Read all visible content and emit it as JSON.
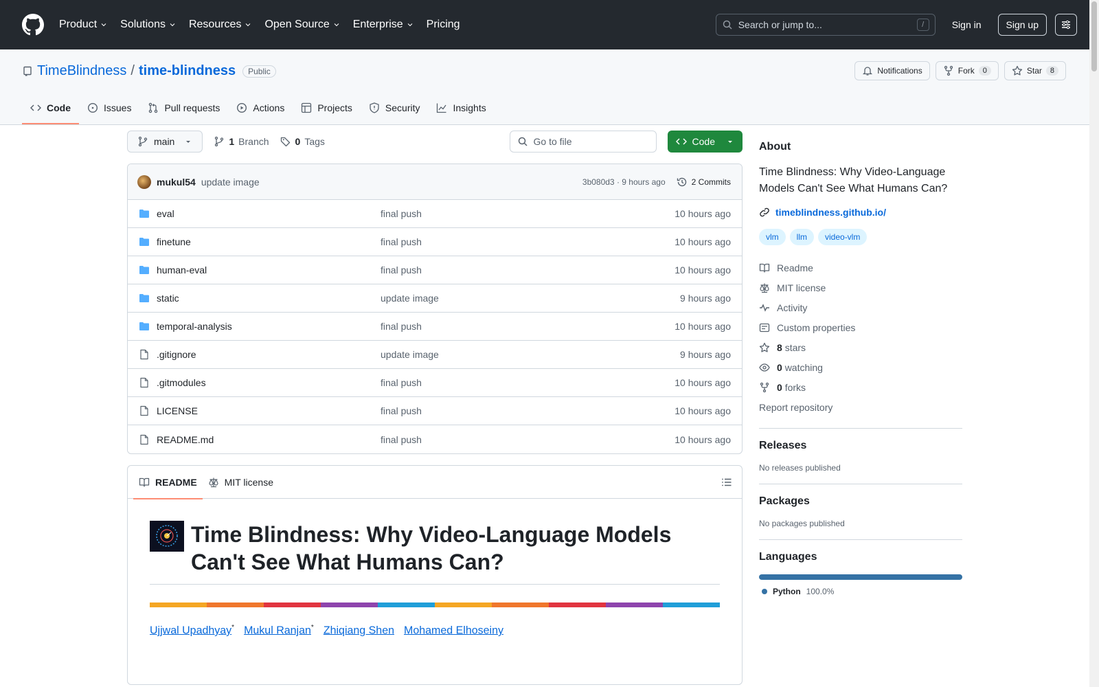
{
  "topnav": {
    "items": [
      "Product",
      "Solutions",
      "Resources",
      "Open Source",
      "Enterprise",
      "Pricing"
    ],
    "search_placeholder": "Search or jump to...",
    "search_shortcut": "/",
    "signin": "Sign in",
    "signup": "Sign up"
  },
  "repo": {
    "owner": "TimeBlindness",
    "name": "time-blindness",
    "visibility": "Public",
    "notifications_label": "Notifications",
    "fork_label": "Fork",
    "fork_count": "0",
    "star_label": "Star",
    "star_count": "8"
  },
  "tabs": [
    "Code",
    "Issues",
    "Pull requests",
    "Actions",
    "Projects",
    "Security",
    "Insights"
  ],
  "toolbar": {
    "branch": "main",
    "branch_count": "1",
    "branch_label": "Branch",
    "tag_count": "0",
    "tag_label": "Tags",
    "goto_placeholder": "Go to file",
    "code_label": "Code"
  },
  "commit": {
    "author": "mukul54",
    "message": "update image",
    "sha_time": "3b080d3 · 9 hours ago",
    "commits": "2 Commits"
  },
  "files": [
    {
      "name": "eval",
      "type": "dir",
      "msg": "final push",
      "date": "10 hours ago"
    },
    {
      "name": "finetune",
      "type": "dir",
      "msg": "final push",
      "date": "10 hours ago"
    },
    {
      "name": "human-eval",
      "type": "dir",
      "msg": "final push",
      "date": "10 hours ago"
    },
    {
      "name": "static",
      "type": "dir",
      "msg": "update image",
      "date": "9 hours ago"
    },
    {
      "name": "temporal-analysis",
      "type": "dir",
      "msg": "final push",
      "date": "10 hours ago"
    },
    {
      "name": ".gitignore",
      "type": "file",
      "msg": "update image",
      "date": "9 hours ago"
    },
    {
      "name": ".gitmodules",
      "type": "file",
      "msg": "final push",
      "date": "10 hours ago"
    },
    {
      "name": "LICENSE",
      "type": "file",
      "msg": "final push",
      "date": "10 hours ago"
    },
    {
      "name": "README.md",
      "type": "file",
      "msg": "final push",
      "date": "10 hours ago"
    }
  ],
  "readme": {
    "tab_readme": "README",
    "tab_license": "MIT license",
    "title": "Time Blindness: Why Video-Language Models Can't See What Humans Can?",
    "authors": [
      {
        "name": "Ujjwal Upadhyay",
        "mark": "*"
      },
      {
        "name": "Mukul Ranjan",
        "mark": "*"
      },
      {
        "name": "Zhiqiang Shen",
        "mark": ""
      },
      {
        "name": "Mohamed Elhoseiny",
        "mark": ""
      }
    ]
  },
  "about": {
    "heading": "About",
    "description": "Time Blindness: Why Video-Language Models Can't See What Humans Can?",
    "homepage": "timeblindness.github.io/",
    "topics": [
      "vlm",
      "llm",
      "video-vlm"
    ],
    "readme": "Readme",
    "license": "MIT license",
    "activity": "Activity",
    "custom_properties": "Custom properties",
    "stars_count": "8",
    "stars_label": "stars",
    "watching_count": "0",
    "watching_label": "watching",
    "forks_count": "0",
    "forks_label": "forks",
    "report": "Report repository"
  },
  "releases": {
    "heading": "Releases",
    "text": "No releases published"
  },
  "packages": {
    "heading": "Packages",
    "text": "No packages published"
  },
  "languages": {
    "heading": "Languages",
    "items": [
      {
        "name": "Python",
        "percent": "100.0%",
        "color": "#3572a5"
      }
    ]
  },
  "colors": {
    "header_bg": "#24292f",
    "link": "#0969da",
    "code_button": "#1f883d",
    "tab_underline": "#fd8c73"
  }
}
